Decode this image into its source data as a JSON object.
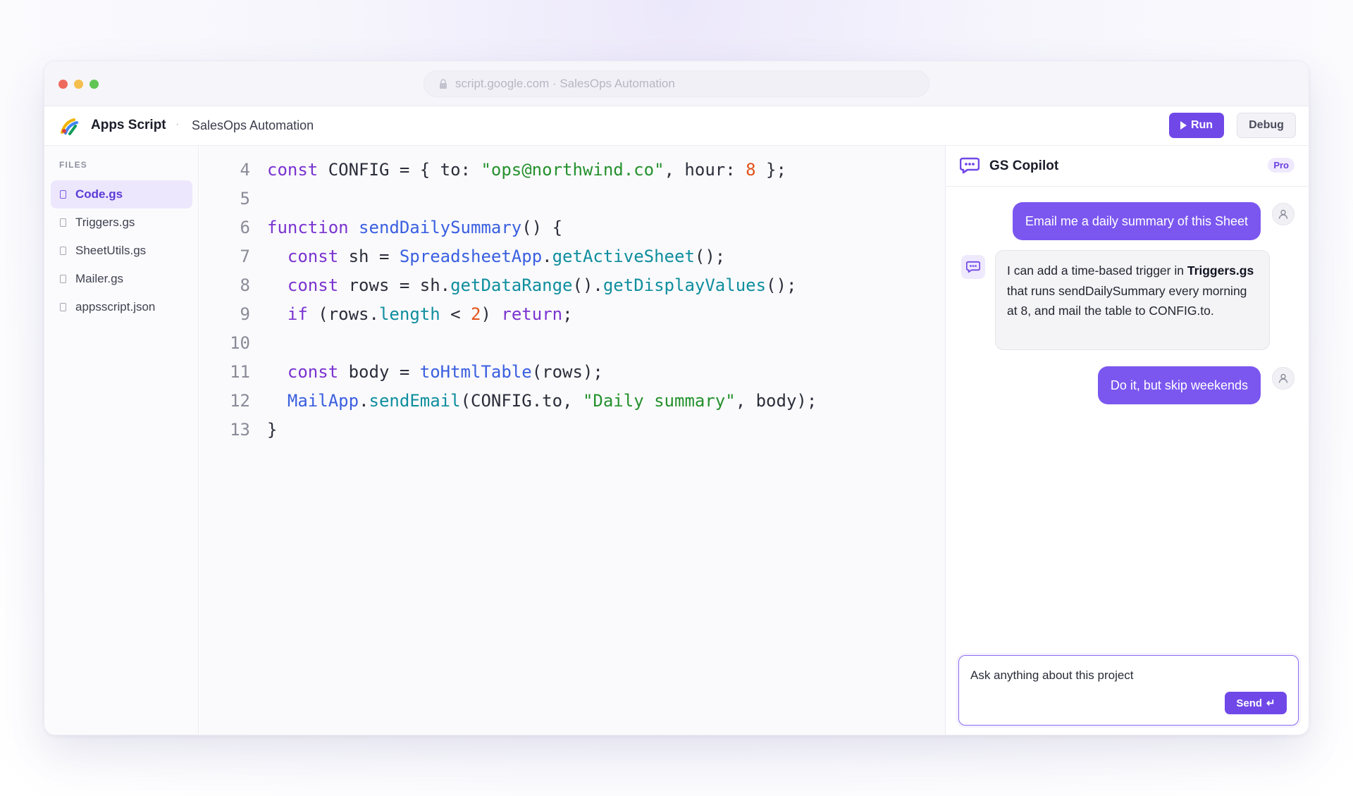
{
  "browser": {
    "url_text": "script.google.com · SalesOps Automation"
  },
  "header": {
    "app_title": "Apps Script",
    "separator": "·",
    "project_name": "SalesOps Automation",
    "run_label": "Run",
    "debug_label": "Debug",
    "accent_color": "#7048e8"
  },
  "sidebar": {
    "section_label": "FILES",
    "files": [
      {
        "label": "Code.gs",
        "active": true
      },
      {
        "label": "Triggers.gs",
        "active": false
      },
      {
        "label": "SheetUtils.gs",
        "active": false
      },
      {
        "label": "Mailer.gs",
        "active": false
      },
      {
        "label": "appsscript.json",
        "active": false
      }
    ]
  },
  "editor": {
    "lines": [
      {
        "n": "4",
        "tokens": [
          [
            "kw",
            "const"
          ],
          [
            "p",
            " CONFIG = { to: "
          ],
          [
            "str",
            "\"ops@northwind.co\""
          ],
          [
            "p",
            ", hour: "
          ],
          [
            "num",
            "8"
          ],
          [
            "p",
            " };"
          ]
        ]
      },
      {
        "n": "5",
        "tokens": []
      },
      {
        "n": "6",
        "tokens": [
          [
            "kw",
            "function"
          ],
          [
            "p",
            " "
          ],
          [
            "fn",
            "sendDailySummary"
          ],
          [
            "p",
            "() {"
          ]
        ]
      },
      {
        "n": "7",
        "tokens": [
          [
            "p",
            "  "
          ],
          [
            "kw",
            "const"
          ],
          [
            "p",
            " sh = "
          ],
          [
            "fn",
            "SpreadsheetApp"
          ],
          [
            "p",
            "."
          ],
          [
            "mt",
            "getActiveSheet"
          ],
          [
            "p",
            "();"
          ]
        ]
      },
      {
        "n": "8",
        "tokens": [
          [
            "p",
            "  "
          ],
          [
            "kw",
            "const"
          ],
          [
            "p",
            " rows = sh."
          ],
          [
            "mt",
            "getDataRange"
          ],
          [
            "p",
            "()."
          ],
          [
            "mt",
            "getDisplayValues"
          ],
          [
            "p",
            "();"
          ]
        ]
      },
      {
        "n": "9",
        "tokens": [
          [
            "p",
            "  "
          ],
          [
            "kw",
            "if"
          ],
          [
            "p",
            " (rows."
          ],
          [
            "mt",
            "length"
          ],
          [
            "p",
            " < "
          ],
          [
            "num",
            "2"
          ],
          [
            "p",
            ") "
          ],
          [
            "kw",
            "return"
          ],
          [
            "p",
            ";"
          ]
        ]
      },
      {
        "n": "10",
        "tokens": []
      },
      {
        "n": "11",
        "tokens": [
          [
            "p",
            "  "
          ],
          [
            "kw",
            "const"
          ],
          [
            "p",
            " body = "
          ],
          [
            "fn",
            "toHtmlTable"
          ],
          [
            "p",
            "(rows);"
          ]
        ]
      },
      {
        "n": "12",
        "tokens": [
          [
            "p",
            "  "
          ],
          [
            "fn",
            "MailApp"
          ],
          [
            "p",
            "."
          ],
          [
            "mt",
            "sendEmail"
          ],
          [
            "p",
            "(CONFIG.to, "
          ],
          [
            "str",
            "\"Daily summary\""
          ],
          [
            "p",
            ", body);"
          ]
        ]
      },
      {
        "n": "13",
        "tokens": [
          [
            "p",
            "}"
          ]
        ]
      }
    ]
  },
  "copilot": {
    "title": "GS Copilot",
    "badge": "Pro",
    "messages": {
      "user_1": "Email me a daily summary of this Sheet",
      "bot_1_pre": "I can add a time-based trigger in ",
      "bot_1_bold": "Triggers.gs",
      "bot_1_post": " that runs sendDailySummary every morning at 8, and mail the table to CONFIG.to.",
      "user_2": "Do it, but skip weekends"
    },
    "composer_text": "Ask anything about this project",
    "send_label": "Send",
    "send_glyph": "↵"
  }
}
